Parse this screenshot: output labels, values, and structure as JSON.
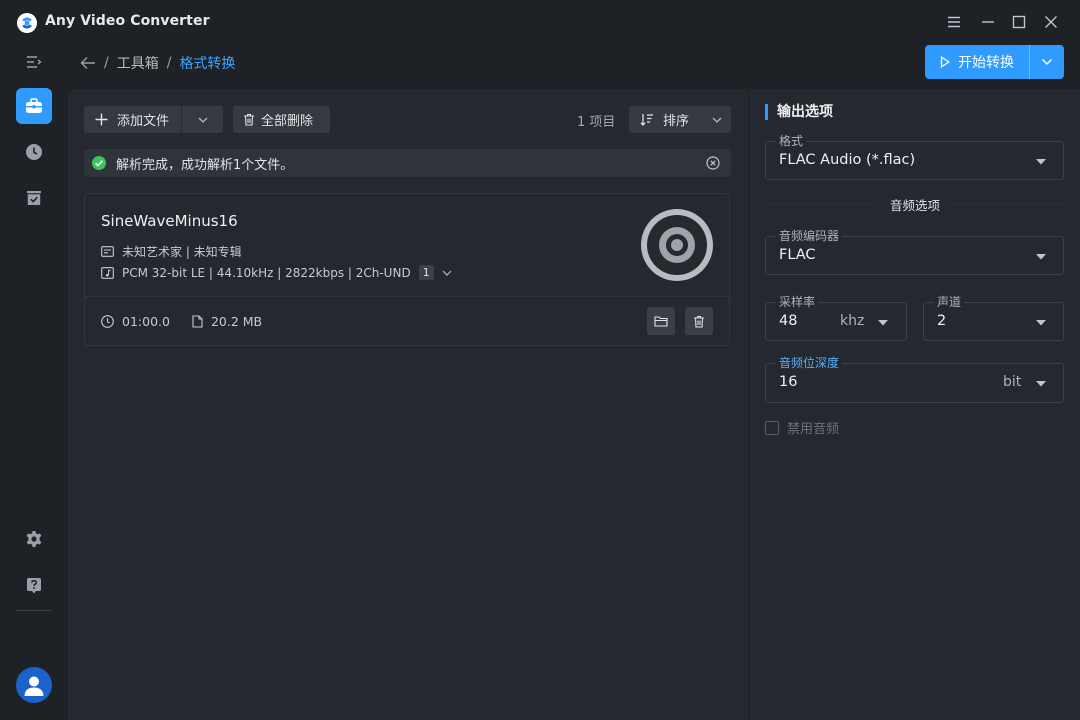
{
  "app": {
    "title": "Any Video Converter"
  },
  "breadcrumb": {
    "parent": "工具箱",
    "current": "格式转换",
    "separator": "/"
  },
  "header": {
    "start_label": "开始转换"
  },
  "toolbar": {
    "add_files": "添加文件",
    "delete_all": "全部删除",
    "item_count": "1 项目",
    "sort": "排序"
  },
  "notice": {
    "text": "解析完成，成功解析1个文件。"
  },
  "file": {
    "name": "SineWaveMinus16",
    "meta": "未知艺术家 | 未知专辑",
    "audio_info": "PCM 32-bit LE | 44.10kHz | 2822kbps | 2Ch-UND",
    "stream_count": "1",
    "duration": "01:00.0",
    "size": "20.2 MB"
  },
  "output": {
    "section_title": "输出选项",
    "format_label": "格式",
    "format_value": "FLAC Audio (*.flac)",
    "audio_section": "音频选项",
    "codec_label": "音频编码器",
    "codec_value": "FLAC",
    "sample_rate_label": "采样率",
    "sample_rate_value": "48",
    "sample_rate_unit": "khz",
    "channel_label": "声道",
    "channel_value": "2",
    "bit_depth_label": "音频位深度",
    "bit_depth_value": "16",
    "bit_depth_unit": "bit",
    "disable_audio": "禁用音频"
  },
  "colors": {
    "accent": "#2f9bff",
    "success": "#3cc45a",
    "background": "#1e2126",
    "panel": "#25282e"
  }
}
